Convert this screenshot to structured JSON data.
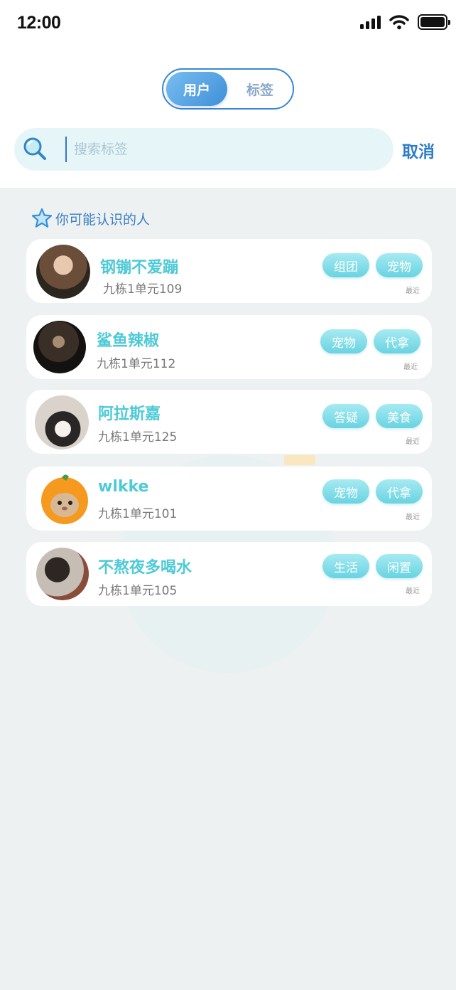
{
  "status_bar": {
    "time": "12:00"
  },
  "toggle": {
    "active_label": "用户",
    "inactive_label": "标签"
  },
  "search": {
    "placeholder": "搜索标签",
    "value": "",
    "cancel_label": "取消"
  },
  "section": {
    "title": "你可能认识的人"
  },
  "people": [
    {
      "name": "钢镚不爱蹦",
      "address": "九栋1单元109",
      "tags": [
        "组团",
        "宠物"
      ],
      "recent": "最近"
    },
    {
      "name": "鲨鱼辣椒",
      "address": "九栋1单元112",
      "tags": [
        "宠物",
        "代拿"
      ],
      "recent": "最近"
    },
    {
      "name": "阿拉斯嘉",
      "address": "九栋1单元125",
      "tags": [
        "答疑",
        "美食"
      ],
      "recent": "最近"
    },
    {
      "name": "wlkke",
      "address": "九栋1单元101",
      "tags": [
        "宠物",
        "代拿"
      ],
      "recent": "最近"
    },
    {
      "name": "不熬夜多喝水",
      "address": "九栋1单元105",
      "tags": [
        "生活",
        "闲置"
      ],
      "recent": "最近"
    }
  ],
  "colors": {
    "accent": "#3b86d4",
    "name": "#4ecad7",
    "tag": "#69d3e1",
    "background": "#edf1f2"
  }
}
